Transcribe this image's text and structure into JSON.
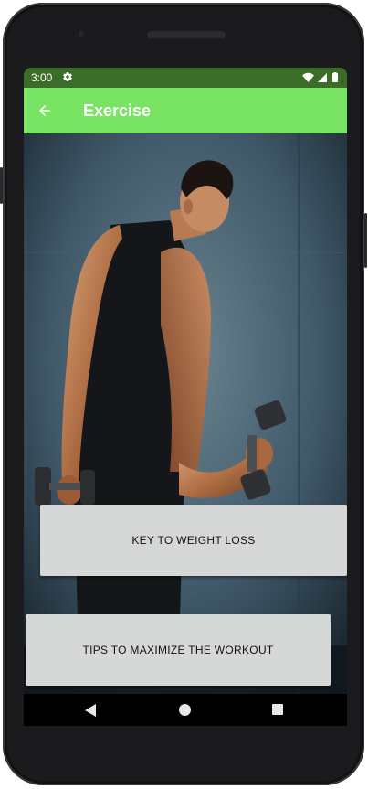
{
  "status_bar": {
    "time": "3:00",
    "icons": [
      "settings-icon",
      "wifi-icon",
      "cell-signal-icon",
      "battery-icon"
    ]
  },
  "app_bar": {
    "title": "Exercise",
    "background_color": "#79e363",
    "back_icon": "arrow-back-icon"
  },
  "hero_image": {
    "description_icon": "dumbbell-workout-image"
  },
  "buttons": {
    "key_to_weight_loss": "KEY TO WEIGHT LOSS",
    "tips_to_maximize": "TIPS TO MAXIMIZE THE WORKOUT"
  },
  "nav_bar": {
    "icons": [
      "nav-back-icon",
      "nav-home-icon",
      "nav-recents-icon"
    ]
  },
  "colors": {
    "status_bar": "#3b6d29",
    "button_bg": "#d6d7d7"
  }
}
